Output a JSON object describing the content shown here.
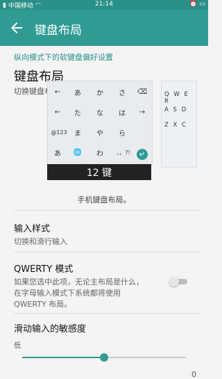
{
  "status_bar": {
    "carrier": "中国移动",
    "time": "21:14"
  },
  "app_bar": {
    "title": "键盘布局"
  },
  "section_header": "纵向模式下的软键盘偏好设置",
  "layout_section": {
    "title": "键盘布局",
    "subtitle": "切换键盘布局。",
    "keyboard_label": "12 键",
    "caption": "手机键盘布局。",
    "keyboard_preview": {
      "row1": [
        "←",
        "あ",
        "か",
        "さ",
        "⌫"
      ],
      "row2": [
        "←",
        "た",
        "な",
        "は",
        "→"
      ],
      "row3": [
        "@123",
        "ま",
        "や",
        "ら",
        ""
      ],
      "row4": [
        "あ",
        "🌐",
        "わ",
        "、。?!",
        "↵"
      ]
    },
    "qwerty_preview": {
      "row1": "Q W E R",
      "row2": "A S D",
      "row3": "Z X C"
    }
  },
  "input_style": {
    "title": "输入样式",
    "desc": "切换和滑行输入"
  },
  "qwerty_mode": {
    "title": "QWERTY 模式",
    "desc_line1": "如果您选中此项，无论主布局是什么，",
    "desc_line2": "在字母输入模式下系统都将使用",
    "desc_line3": "QWERTY 布局。",
    "enabled": false
  },
  "sensitivity": {
    "title": "滑动输入的敏感度",
    "value": "0",
    "low_label": "低",
    "level_fraction": 0.5
  }
}
